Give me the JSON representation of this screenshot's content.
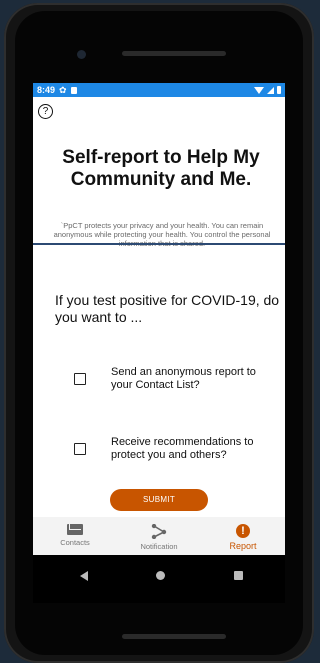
{
  "status_bar": {
    "time": "8:49"
  },
  "title": "Self-report to Help My Community and Me.",
  "privacy_note": "`PpCT protects your privacy and your health. You can remain anonymous while protecting your health. You control the personal information that is shared.",
  "question": "If you test positive for COVID-19, do you want to ...",
  "options": [
    {
      "label": "Send an anonymous report to your Contact List?",
      "checked": false
    },
    {
      "label": "Receive recommendations to protect you and others?",
      "checked": false
    }
  ],
  "submit_label": "SUBMIT",
  "bottom_nav": [
    {
      "label": "Contacts",
      "icon": "mail-icon",
      "active": false
    },
    {
      "label": "Notification",
      "icon": "share-icon",
      "active": false
    },
    {
      "label": "Report",
      "icon": "alert-icon",
      "active": true
    }
  ],
  "help_icon": "question-mark-circle-icon",
  "colors": {
    "status_bar": "#1e88e5",
    "accent": "#c85500",
    "divider": "#2c4a73"
  }
}
